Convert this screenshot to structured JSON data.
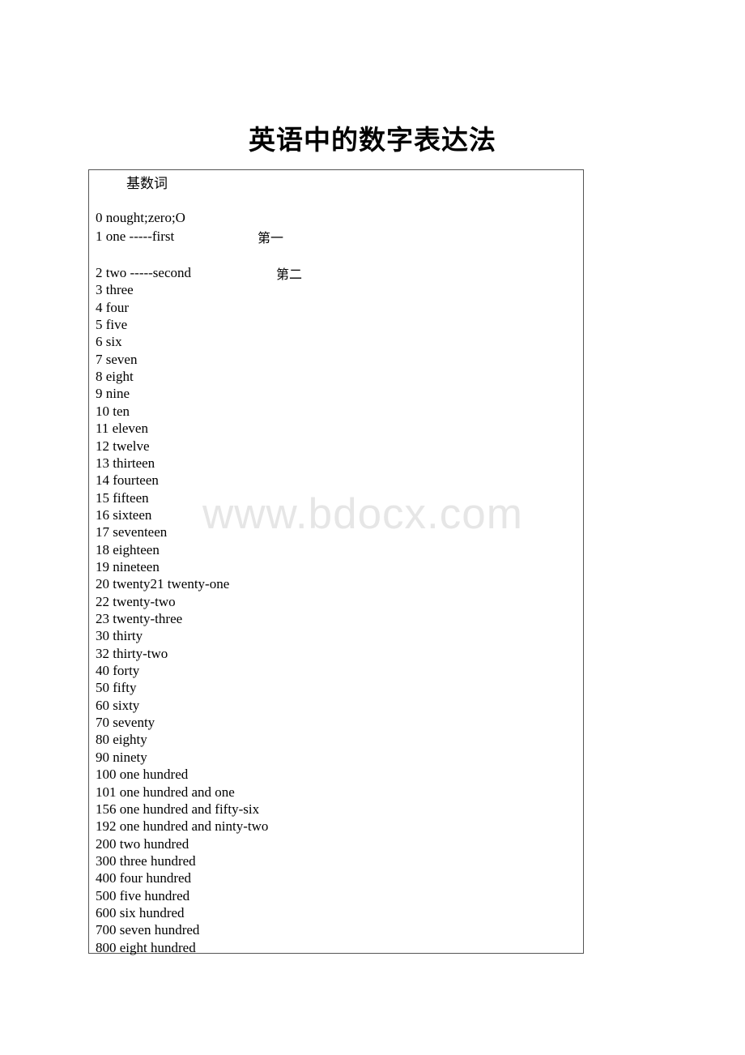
{
  "document": {
    "title": "英语中的数字表达法",
    "section_heading": "基数词",
    "watermark": "www.bdocx.com",
    "lines": [
      "0 nought;zero;O",
      "1 one -----first",
      "2 two -----second",
      "3 three",
      "4 four",
      "5 five",
      "6 six",
      "7 seven",
      "8 eight",
      "9 nine",
      "10 ten",
      "11 eleven",
      "12 twelve",
      "13 thirteen",
      "14 fourteen",
      "15 fifteen",
      "16 sixteen",
      "17 seventeen",
      "18 eighteen",
      "19 nineteen",
      "20 twenty21 twenty-one",
      "22 twenty-two",
      "23 twenty-three",
      "30 thirty",
      "32 thirty-two",
      "40 forty",
      "50 fifty",
      "60 sixty",
      "70 seventy",
      "80 eighty",
      "90 ninety",
      "100 one hundred",
      "101 one hundred and one",
      "156 one hundred and fifty-six",
      "192 one hundred and ninty-two",
      "200 two hundred",
      "300 three hundred",
      "400 four hundred",
      "500 five hundred",
      "600 six hundred",
      "700 seven hundred",
      "800 eight hundred"
    ],
    "annotations": {
      "first": "第一",
      "second": "第二"
    }
  }
}
